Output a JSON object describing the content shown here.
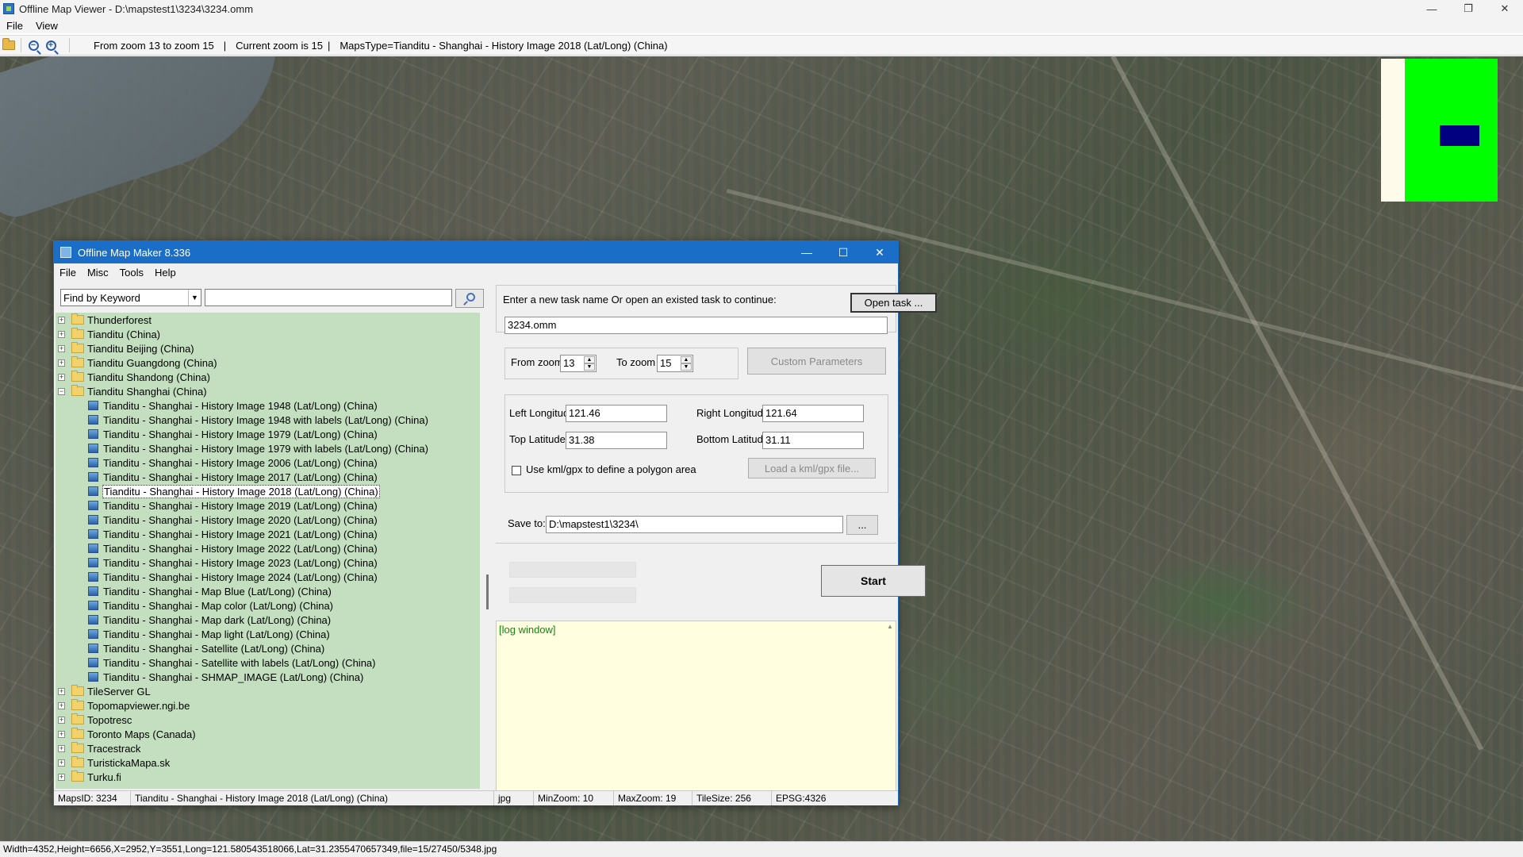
{
  "viewer": {
    "title": "Offline Map Viewer - D:\\mapstest1\\3234\\3234.omm",
    "controls": {
      "minimize": "—",
      "maximize": "❐",
      "close": "✕"
    },
    "menu": [
      "File",
      "View"
    ],
    "toolbar": {
      "zoom_range": "From zoom 13 to zoom 15",
      "sep1": "|",
      "current_zoom": "Current zoom is 15",
      "sep2": "|",
      "maps_type": "MapsType=Tianditu - Shanghai - History Image 2018 (Lat/Long) (China)"
    },
    "status": "Width=4352,Height=6656,X=2952,Y=3551,Long=121.580543518066,Lat=31.2355470657349,file=15/27450/5348.jpg"
  },
  "colors": {
    "dialog_titlebar": "#1a6ec7",
    "tree_bg": "#c3dfc0",
    "log_bg": "#ffffe0",
    "minimap_green": "#00ff00",
    "minimap_view": "#000080"
  },
  "dialog": {
    "title": "Offline Map Maker 8.336",
    "controls": {
      "minimize": "—",
      "maximize": "☐",
      "close": "✕"
    },
    "menu": [
      "File",
      "Misc",
      "Tools",
      "Help"
    ],
    "find": {
      "mode": "Find by Keyword",
      "query": ""
    },
    "tree": {
      "before": [
        "Thunderforest",
        "Tianditu (China)",
        "Tianditu Beijing (China)",
        "Tianditu Guangdong (China)",
        "Tianditu Shandong (China)"
      ],
      "expanded": "Tianditu Shanghai (China)",
      "children": [
        "Tianditu - Shanghai - History Image 1948 (Lat/Long) (China)",
        "Tianditu - Shanghai - History Image 1948 with labels (Lat/Long) (China)",
        "Tianditu - Shanghai - History Image 1979 (Lat/Long) (China)",
        "Tianditu - Shanghai - History Image 1979 with labels (Lat/Long) (China)",
        "Tianditu - Shanghai - History Image 2006 (Lat/Long) (China)",
        "Tianditu - Shanghai - History Image 2017 (Lat/Long) (China)",
        "Tianditu - Shanghai - History Image 2018 (Lat/Long) (China)",
        "Tianditu - Shanghai - History Image 2019 (Lat/Long) (China)",
        "Tianditu - Shanghai - History Image 2020 (Lat/Long) (China)",
        "Tianditu - Shanghai - History Image 2021 (Lat/Long) (China)",
        "Tianditu - Shanghai - History Image 2022 (Lat/Long) (China)",
        "Tianditu - Shanghai - History Image 2023 (Lat/Long) (China)",
        "Tianditu - Shanghai - History Image 2024 (Lat/Long) (China)",
        "Tianditu - Shanghai - Map Blue (Lat/Long) (China)",
        "Tianditu - Shanghai - Map color (Lat/Long) (China)",
        "Tianditu - Shanghai - Map dark (Lat/Long) (China)",
        "Tianditu - Shanghai - Map light (Lat/Long) (China)",
        "Tianditu - Shanghai - Satellite (Lat/Long) (China)",
        "Tianditu - Shanghai - Satellite with labels (Lat/Long) (China)",
        "Tianditu - Shanghai - SHMAP_IMAGE (Lat/Long) (China)"
      ],
      "selected_index": 6,
      "after": [
        "TileServer GL",
        "Topomapviewer.ngi.be",
        "Topotresc",
        "Toronto Maps (Canada)",
        "Tracestrack",
        "TuristickaMapa.sk",
        "Turku.fi"
      ]
    },
    "task": {
      "prompt": "Enter a new task name Or open an existed task to continue:",
      "open_button": "Open task ...",
      "name": "3234.omm"
    },
    "zoom": {
      "from_label": "From zoom",
      "from_value": "13",
      "to_label": "To zoom",
      "to_value": "15",
      "custom_button": "Custom Parameters"
    },
    "coords": {
      "left_label": "Left Longitude",
      "left_value": "121.46",
      "right_label": "Right Longitude",
      "right_value": "121.64",
      "top_label": "Top Latitude",
      "top_value": "31.38",
      "bottom_label": "Bottom Latitude",
      "bottom_value": "31.11",
      "kml_checkbox": "Use kml/gpx to define a polygon area",
      "kml_button": "Load a kml/gpx file...",
      "kml_checked": false
    },
    "save": {
      "label": "Save to:",
      "path": "D:\\mapstest1\\3234\\",
      "browse": "..."
    },
    "start_button": "Start",
    "log_text": "[log window]",
    "status": {
      "maps_id": "MapsID: 3234",
      "map_name": "Tianditu - Shanghai - History Image 2018 (Lat/Long) (China)",
      "format": "jpg",
      "min_zoom": "MinZoom: 10",
      "max_zoom": "MaxZoom: 19",
      "tile_size": "TileSize: 256",
      "epsg": "EPSG:4326"
    }
  }
}
